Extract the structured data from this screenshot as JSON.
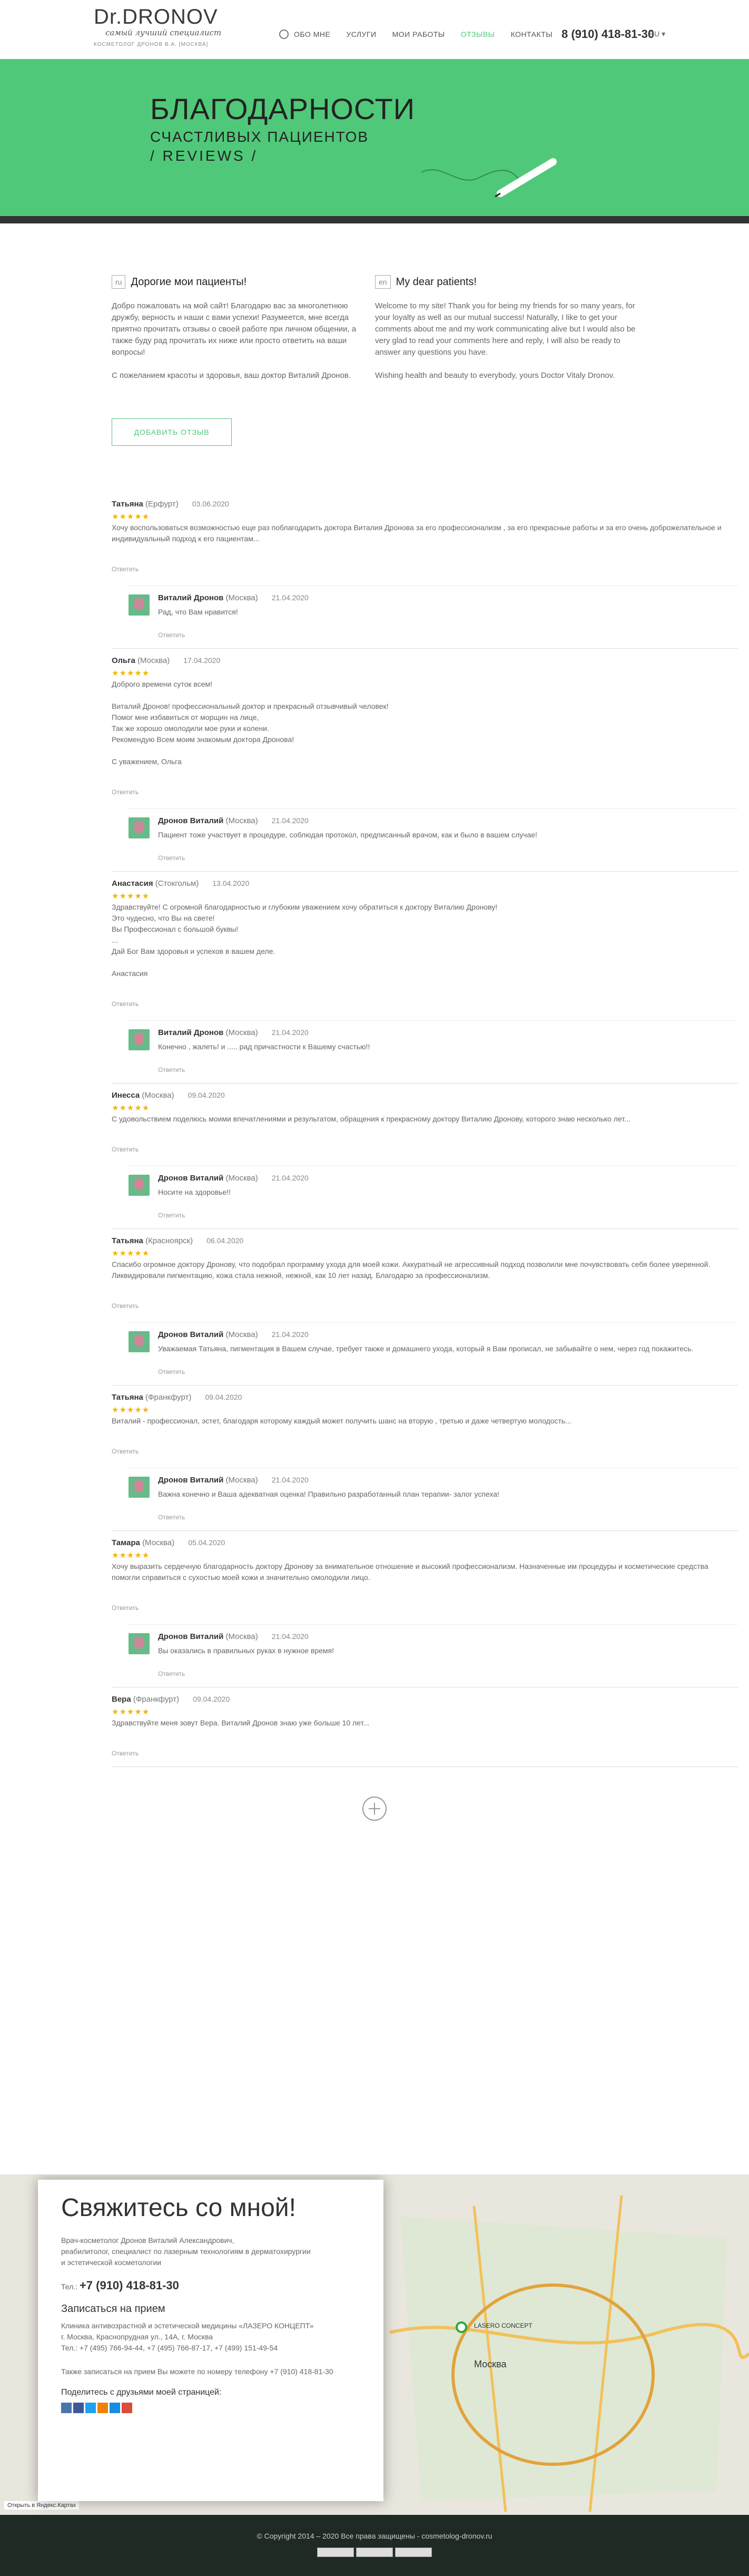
{
  "header": {
    "logo": "Dr.DRONOV",
    "logo_sub": "самый лучший специалист",
    "logo_caption": "КОСМЕТОЛОГ ДРОНОВ В.А. [МОСКВА]",
    "nav": [
      "ОБО МНЕ",
      "УСЛУГИ",
      "МОИ РАБОТЫ",
      "ОТЗЫВЫ",
      "КОНТАКТЫ"
    ],
    "phone": "8 (910) 418-81-30",
    "lang": "RU ▾"
  },
  "banner": {
    "title": "БЛАГОДАРНОСТИ",
    "subtitle": "СЧАСТЛИВЫХ ПАЦИЕНТОВ",
    "en": "/ REVIEWS /"
  },
  "intro": {
    "ru": {
      "tag": "ru",
      "title": "Дорогие мои пациенты!",
      "text": "Добро пожаловать на мой сайт! Благодарю вас за многолетнюю дружбу, верность и наши с вами успехи! Разумеется, мне всегда приятно прочитать отзывы о своей работе при личном общении, а также буду рад прочитать их ниже или просто ответить на ваши вопросы!\n\nС пожеланием красоты и здоровья, ваш доктор Виталий Дронов."
    },
    "en": {
      "tag": "en",
      "title": "My dear patients!",
      "text": "Welcome to my site! Thank you for being my friends for so many years, for your loyalty as well as our mutual success! Naturally, I like to get your comments about me and my work communicating alive but I would also be very glad to read your comments here and reply, I will also be ready to answer any questions you have.\n\nWishing health and beauty to everybody, yours Doctor Vitaly Dronov."
    },
    "add_btn": "ДОБАВИТЬ ОТЗЫВ"
  },
  "reviews": [
    {
      "name": "Татьяна",
      "city": "(Ерфурт)",
      "date": "03.06.2020",
      "text": "Хочу воспользоваться возможностью еще раз поблагодарить доктора Виталия Дронова за его профессионализм , за его прекрасные работы и за его очень доброжелательное и индивидуальный подход к его пациентам...",
      "answer": "Ответить",
      "reply": {
        "name": "Виталий Дронов",
        "city": "(Москва)",
        "date": "21.04.2020",
        "text": "Рад, что Вам нравится!",
        "answer": "Ответить"
      }
    },
    {
      "name": "Ольга",
      "city": "(Москва)",
      "date": "17.04.2020",
      "text": "Доброго времени суток всем!\n\nВиталий Дронов! профессиональный доктор и прекрасный отзывчивый человек!\nПомог мне избавиться от морщин на лице,\nТак же хорошо омолодили мое руки и колени.\nРекомендую Всем моим знакомым доктора Дронова!\n\nС уважением, Ольга",
      "answer": "Ответить",
      "reply": {
        "name": "Дронов Виталий",
        "city": "(Москва)",
        "date": "21.04.2020",
        "text": "Пациент тоже участвует в процедуре, соблюдая протокол, предписанный врачом, как и было в вашем случае!",
        "answer": "Ответить"
      }
    },
    {
      "name": "Анастасия",
      "city": "(Стокгольм)",
      "date": "13.04.2020",
      "text": "Здравствуйте! С огромной благодарностью и глубоким уважением хочу обратиться к доктору Виталию Дронову!\nЭто чудесно, что Вы на свете!\nВы Профессионал с большой буквы!\n...\nДай Бог Вам здоровья и успехов в вашем деле.\n\nАнастасия",
      "answer": "Ответить",
      "reply": {
        "name": "Виталий Дронов",
        "city": "(Москва)",
        "date": "21.04.2020",
        "text": "Конечно , жалеть! и ..... рад причастности к Вашему счастью!!",
        "answer": "Ответить"
      }
    },
    {
      "name": "Инесса",
      "city": "(Москва)",
      "date": "09.04.2020",
      "text": "С удовольствием поделюсь моими впечатлениями и результатом, обращения к прекрасному доктору Виталию Дронову, которого знаю несколько лет...",
      "answer": "Ответить",
      "reply": {
        "name": "Дронов Виталий",
        "city": "(Москва)",
        "date": "21.04.2020",
        "text": "Носите на здоровье!!",
        "answer": "Ответить"
      }
    },
    {
      "name": "Татьяна",
      "city": "(Красноярск)",
      "date": "06.04.2020",
      "text": "Спасибо огромное доктору Дронову, что подобрал программу ухода для моей кожи. Аккуратный не агрессивный подход позволили мне почувствовать себя более уверенной. Ликвидировали пигментацию, кожа стала нежной, нежной, как 10 лет назад. Благодарю за профессионализм.",
      "answer": "Ответить",
      "reply": {
        "name": "Дронов Виталий",
        "city": "(Москва)",
        "date": "21.04.2020",
        "text": "Уважаемая Татьяна, пигментация в Вашем случае, требует также и домашнего ухода, который я Вам прописал, не забывайте о нем, через год покажитесь.",
        "answer": "Ответить"
      }
    },
    {
      "name": "Татьяна",
      "city": "(Франкфурт)",
      "date": "09.04.2020",
      "text": "Виталий - профессионал, эстет, благодаря которому каждый может получить шанс на вторую , третью и даже четвертую молодость...",
      "answer": "Ответить",
      "reply": {
        "name": "Дронов Виталий",
        "city": "(Москва)",
        "date": "21.04.2020",
        "text": "Важна конечно и Ваша адекватная оценка! Правильно разработанный план терапии- залог успеха!",
        "answer": "Ответить"
      }
    },
    {
      "name": "Тамара",
      "city": "(Москва)",
      "date": "05.04.2020",
      "text": "Хочу выразить сердечную благодарность доктору Дронову за внимательное отношение и высокий профессионализм. Назначенные им процедуры и косметические средства помогли справиться с сухостью моей кожи и значительно омолодили лицо.",
      "answer": "Ответить",
      "reply": {
        "name": "Дронов Виталий",
        "city": "(Москва)",
        "date": "21.04.2020",
        "text": "Вы оказались в правильных руках в нужное время!",
        "answer": "Ответить"
      }
    },
    {
      "name": "Вера",
      "city": "(Франкфурт)",
      "date": "09.04.2020",
      "text": "Здравствуйте меня зовут Вера. Виталий Дронов знаю уже больше 10 лет...",
      "answer": "Ответить"
    }
  ],
  "contact": {
    "title": "Свяжитесь со мной!",
    "bio": "Врач-косметолог Дронов Виталий Александрович,\nреабилитолог, специалист по лазерным технологиям в дерматохирургии\nи эстетической косметологии",
    "phone_label": "Тел.:",
    "phone": "+7 (910) 418-81-30",
    "appt_title": "Записаться на прием",
    "clinic": "Клиника антивозрастной и эстетической медицины «ЛАЗЕРО КОНЦЕПТ»\nг. Москва, Краснопрудная ул., 14А, г. Москва\nТел.: +7 (495) 766-94-44, +7 (495) 766-87-17, +7 (499) 151-49-54",
    "note": "Также записаться на прием Вы можете по номеру телефону +7 (910) 418-81-30",
    "share_title": "Поделитесь с друзьями моей страницей:",
    "map_label": "LASERO CONCEPT",
    "map_city": "Москва",
    "map_open": "Открыть в Яндекс.Картах"
  },
  "footer": {
    "copyright": "© Copyright 2014 – 2020 Все права защищены - cosmetolog-dronov.ru"
  },
  "colors": {
    "accent": "#50c879",
    "footer": "#1f2a25"
  }
}
